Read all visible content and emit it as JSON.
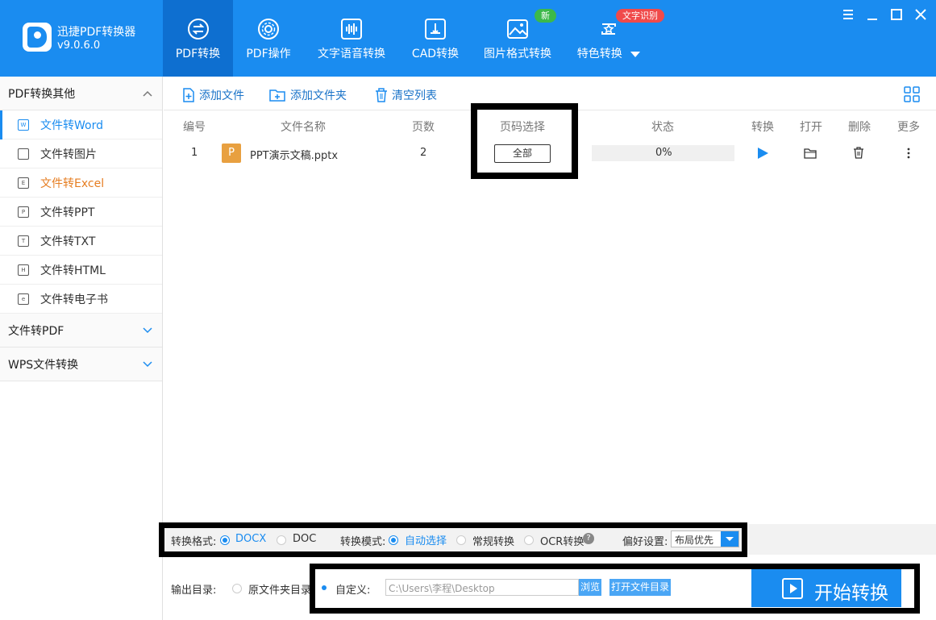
{
  "app": {
    "title": "迅捷PDF转换器",
    "version": "v9.0.6.0"
  },
  "nav": [
    {
      "label": "PDF转换"
    },
    {
      "label": "PDF操作"
    },
    {
      "label": "文字语音转换"
    },
    {
      "label": "CAD转换"
    },
    {
      "label": "图片格式转换"
    },
    {
      "label": "特色转换"
    }
  ],
  "badges": {
    "new": "新",
    "ocr": "文字识别"
  },
  "sidebar": {
    "group1": "PDF转换其他",
    "items": [
      {
        "label": "文件转Word",
        "icon": "W"
      },
      {
        "label": "文件转图片",
        "icon": ""
      },
      {
        "label": "文件转Excel",
        "icon": "E"
      },
      {
        "label": "文件转PPT",
        "icon": "P"
      },
      {
        "label": "文件转TXT",
        "icon": "T"
      },
      {
        "label": "文件转HTML",
        "icon": "H"
      },
      {
        "label": "文件转电子书",
        "icon": "e"
      }
    ],
    "group2": "文件转PDF",
    "group3": "WPS文件转换"
  },
  "toolbar": {
    "add_file": "添加文件",
    "add_folder": "添加文件夹",
    "clear_list": "清空列表"
  },
  "table": {
    "headers": {
      "num": "编号",
      "name": "文件名称",
      "pages": "页数",
      "page_select": "页码选择",
      "status": "状态",
      "convert": "转换",
      "open": "打开",
      "delete": "删除",
      "more": "更多"
    },
    "rows": [
      {
        "num": "1",
        "file_icon": "P",
        "name": "PPT演示文稿.pptx",
        "pages": "2",
        "page_select": "全部",
        "status": "0%"
      }
    ]
  },
  "options": {
    "format_label": "转换格式:",
    "format_docx": "DOCX",
    "format_doc": "DOC",
    "mode_label": "转换模式:",
    "mode_auto": "自动选择",
    "mode_normal": "常规转换",
    "mode_ocr": "OCR转换",
    "pref_label": "偏好设置:",
    "pref_value": "布局优先"
  },
  "output": {
    "label": "输出目录:",
    "original": "原文件夹目录",
    "custom": "自定义:",
    "path": "C:\\Users\\李程\\Desktop",
    "browse": "浏览",
    "open_dir": "打开文件目录",
    "start": "开始转换"
  },
  "colors": {
    "brand": "#1a8cf0",
    "active_nav": "#0e6fd0",
    "new_badge": "#3cb94a",
    "ocr_badge": "#f04a4a",
    "orange": "#e67e22"
  }
}
